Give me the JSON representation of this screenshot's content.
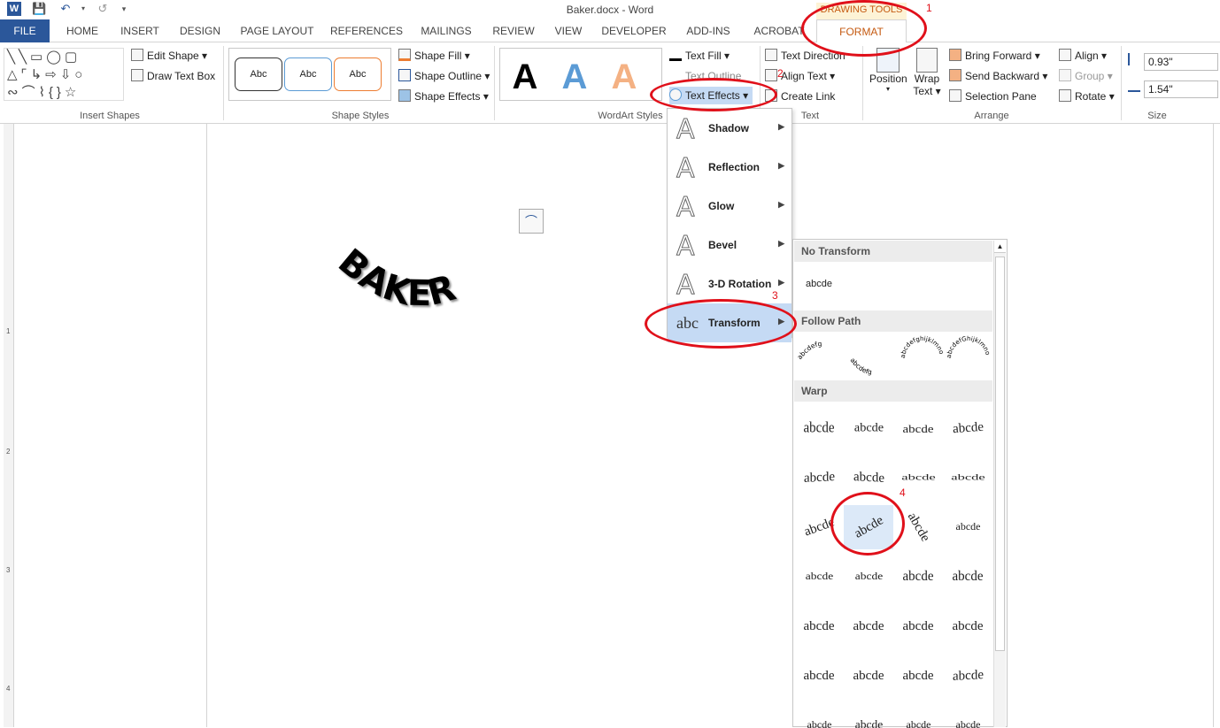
{
  "window": {
    "title": "Baker.docx - Word"
  },
  "tabs": [
    "FILE",
    "HOME",
    "INSERT",
    "DESIGN",
    "PAGE LAYOUT",
    "REFERENCES",
    "MAILINGS",
    "REVIEW",
    "VIEW",
    "DEVELOPER",
    "ADD-INS",
    "ACROBAT"
  ],
  "contextual": {
    "group": "DRAWING TOOLS",
    "tab": "FORMAT"
  },
  "ribbon": {
    "insert_shapes": {
      "label": "Insert Shapes",
      "edit_shape": "Edit Shape",
      "draw_text_box": "Draw Text Box"
    },
    "shape_styles": {
      "label": "Shape Styles",
      "preset": "Abc",
      "fill": "Shape Fill",
      "outline": "Shape Outline",
      "effects": "Shape Effects"
    },
    "wordart": {
      "label": "WordArt Styles",
      "glyph": "A",
      "text_fill": "Text Fill",
      "text_outline": "Text Outline",
      "text_effects": "Text Effects"
    },
    "text": {
      "label": "Text",
      "direction": "Text Direction",
      "align": "Align Text",
      "create_link": "Create Link"
    },
    "arrange": {
      "label": "Arrange",
      "position": "Position",
      "wrap": "Wrap",
      "wrap2": "Text",
      "forward": "Bring Forward",
      "backward": "Send Backward",
      "selection": "Selection Pane",
      "align": "Align",
      "group": "Group",
      "rotate": "Rotate"
    },
    "size": {
      "label": "Size",
      "height": "0.93\"",
      "width": "1.54\""
    }
  },
  "document": {
    "wordart_text": "BAKER"
  },
  "effects_menu": [
    {
      "label": "Shadow",
      "underline": "S"
    },
    {
      "label": "Reflection",
      "underline": "R"
    },
    {
      "label": "Glow",
      "underline": "G"
    },
    {
      "label": "Bevel",
      "underline": "B"
    },
    {
      "label": "3-D Rotation",
      "underline": "D"
    },
    {
      "label": "Transform",
      "underline": "T",
      "icon": "abc"
    }
  ],
  "transform": {
    "no_transform": "No Transform",
    "no_transform_sample": "abcde",
    "follow_path": "Follow Path",
    "warp": "Warp",
    "sample": "abcde",
    "path_samples": [
      "abcdefg",
      "abcdefg",
      "abcdefghijklmno",
      "abcdefGhijklmno"
    ]
  },
  "callouts": [
    "1",
    "2",
    "3",
    "4"
  ],
  "ruler": [
    "1",
    "2",
    "3",
    "4"
  ],
  "colors": {
    "file_tab": "#2b579a",
    "contextual": "#c55a11",
    "highlight": "#c5daf4",
    "annotation": "#e0101a"
  }
}
